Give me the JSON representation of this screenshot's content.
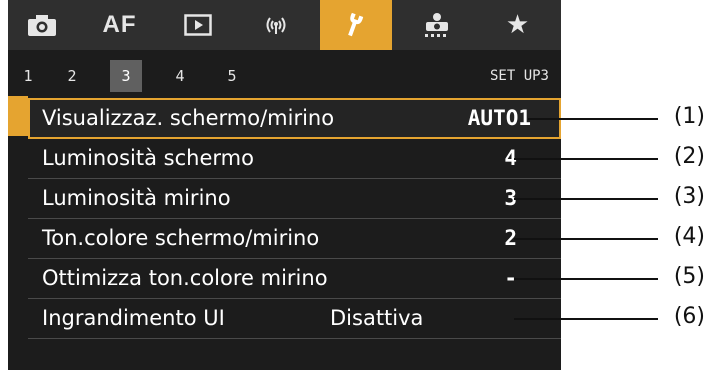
{
  "tabs": [
    {
      "name": "shooting-tab",
      "icon": "camera-icon",
      "label": "",
      "active": false
    },
    {
      "name": "af-tab",
      "icon": "af-icon",
      "label": "AF",
      "active": false
    },
    {
      "name": "playback-tab",
      "icon": "playback-icon",
      "label": "",
      "active": false
    },
    {
      "name": "wireless-tab",
      "icon": "wireless-icon",
      "label": "((̣·))",
      "active": false
    },
    {
      "name": "setup-tab",
      "icon": "wrench-icon",
      "label": "",
      "active": true
    },
    {
      "name": "custom-functions-tab",
      "icon": "camera-person-icon",
      "label": "",
      "active": false
    },
    {
      "name": "my-menu-tab",
      "icon": "star-icon",
      "label": "★",
      "active": false
    }
  ],
  "subpages": [
    "1",
    "2",
    "3",
    "4",
    "5"
  ],
  "active_subpage": "3",
  "page_title": "SET UP3",
  "menu": [
    {
      "label": "Visualizzaz. schermo/mirino",
      "value": "AUTO1",
      "callout": "(1)"
    },
    {
      "label": "Luminosità schermo",
      "value": "4",
      "callout": "(2)"
    },
    {
      "label": "Luminosità mirino",
      "value": "3",
      "callout": "(3)"
    },
    {
      "label": "Ton.colore schermo/mirino",
      "value": "2",
      "callout": "(4)"
    },
    {
      "label": "Ottimizza ton.colore mirino",
      "value": "-",
      "callout": "(5)"
    },
    {
      "label": "Ingrandimento UI",
      "value": "Disattiva",
      "callout": "(6)"
    }
  ],
  "colors": {
    "accent": "#e5a430",
    "background": "#1c1c1c",
    "tabbar": "#2f2f2f"
  }
}
